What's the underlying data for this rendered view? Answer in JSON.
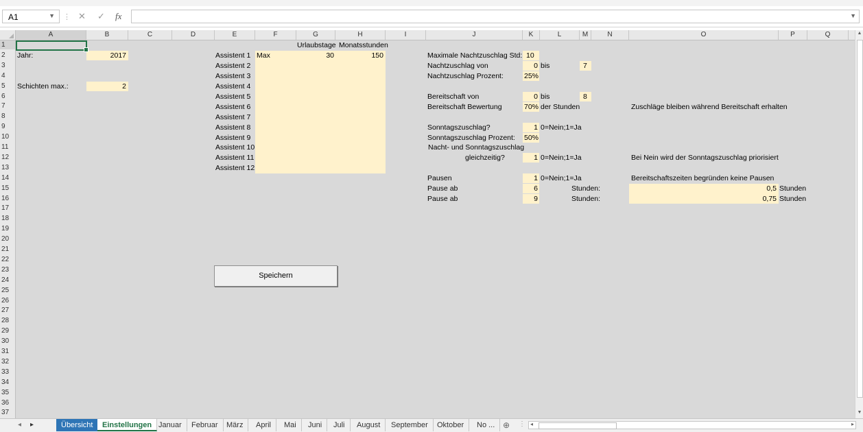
{
  "formula_bar": {
    "name_box": "A1",
    "fx_label": "fx",
    "formula": ""
  },
  "columns": [
    "A",
    "B",
    "C",
    "D",
    "E",
    "F",
    "G",
    "H",
    "I",
    "J",
    "K",
    "L",
    "M",
    "N",
    "O",
    "P",
    "Q"
  ],
  "rows": [
    "1",
    "2",
    "3",
    "4",
    "5",
    "6",
    "7",
    "8",
    "9",
    "10",
    "11",
    "12",
    "13",
    "14",
    "15",
    "16",
    "17",
    "18",
    "19",
    "20",
    "21",
    "22",
    "23",
    "24",
    "25",
    "26",
    "27",
    "28",
    "29",
    "30",
    "31",
    "32",
    "33",
    "34",
    "35",
    "36",
    "37"
  ],
  "cells": {
    "a2": "Jahr:",
    "b2": "2017",
    "a5": "Schichten max.:",
    "b5": "2",
    "g1": "Urlaubstage",
    "h1": "Monatsstunden",
    "e2": "Assistent 1",
    "f2": "Max",
    "g2": "30",
    "h2": "150",
    "e3": "Assistent 2",
    "e4": "Assistent 3",
    "e5": "Assistent 4",
    "e6": "Assistent 5",
    "e7": "Assistent 6",
    "e8": "Assistent 7",
    "e9": "Assistent 8",
    "e10": "Assistent 9",
    "e11": "Assistent 10",
    "e12": "Assistent 11",
    "e13": "Assistent 12",
    "j2": "Maximale Nachtzuschlag Std:",
    "k2": "10",
    "j3": "Nachtzuschlag von",
    "k3": "0",
    "l3": "bis",
    "m3": "7",
    "j4": "Nachtzuschlag Prozent:",
    "k4": "25%",
    "j6": "Bereitschaft von",
    "k6": "0",
    "l6": "bis",
    "m6": "8",
    "j7": "Bereitschaft Bewertung",
    "k7": "70%",
    "l7": "der Stunden",
    "o7": "Zuschläge bleiben während Bereitschaft erhalten",
    "j9": "Sonntagszuschlag?",
    "k9": "1",
    "l9": "0=Nein;1=Ja",
    "j10": "Sonntagszuschlag Prozent:",
    "k10": "50%",
    "j11": "Nacht- und Sonntagszuschlag",
    "j12": "gleichzeitig?",
    "k12": "1",
    "l12": "0=Nein;1=Ja",
    "o12": "Bei Nein wird der Sonntagszuschlag priorisiert",
    "j14": "Pausen",
    "k14": "1",
    "l14": "0=Nein;1=Ja",
    "o14": "Bereitschaftszeiten begründen keine Pausen",
    "j15": "Pause ab",
    "k15": "6",
    "m15": "Stunden:",
    "o15": "0,5",
    "p15": "Stunden",
    "j16": "Pause ab",
    "k16": "9",
    "m16": "Stunden:",
    "o16": "0,75",
    "p16": "Stunden"
  },
  "button": {
    "label": "Speichern"
  },
  "sheet_tabs": [
    "Übersicht",
    "Einstellungen",
    "Januar",
    "Februar",
    "März",
    "April",
    "Mai",
    "Juni",
    "Juli",
    "August",
    "September",
    "Oktober",
    "No ..."
  ],
  "active_tab": "Einstellungen",
  "colors": {
    "input_fill": "#fff2cc",
    "excel_green": "#217346",
    "tab_blue": "#2e75b6",
    "sheet_bg": "#d9d9d9"
  }
}
